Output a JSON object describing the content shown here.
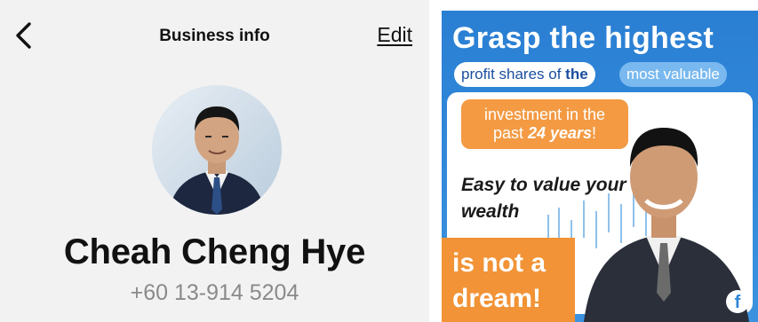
{
  "header": {
    "back_icon": "chevron-left-icon",
    "title": "Business info",
    "edit_label": "Edit"
  },
  "profile": {
    "avatar_icon": "profile-photo",
    "name": "Cheah Cheng Hye",
    "phone": "+60 13-914 5204"
  },
  "ad": {
    "title": "Grasp the highest",
    "pill_white_prefix": "profit shares of ",
    "pill_white_bold": "the",
    "pill_blue": "most valuable",
    "orange_line1": "investment in the",
    "orange_line2_prefix": "past ",
    "orange_line2_bold": "24 years",
    "orange_line2_suffix": "!",
    "easy_line1": "Easy to value your",
    "easy_line2": "wealth",
    "dream_line1": "is not a",
    "dream_line2": "dream!",
    "social_icon": "facebook-icon",
    "colors": {
      "background": "#2f86d6",
      "orange": "#f39a43",
      "text_white": "#ffffff"
    }
  }
}
